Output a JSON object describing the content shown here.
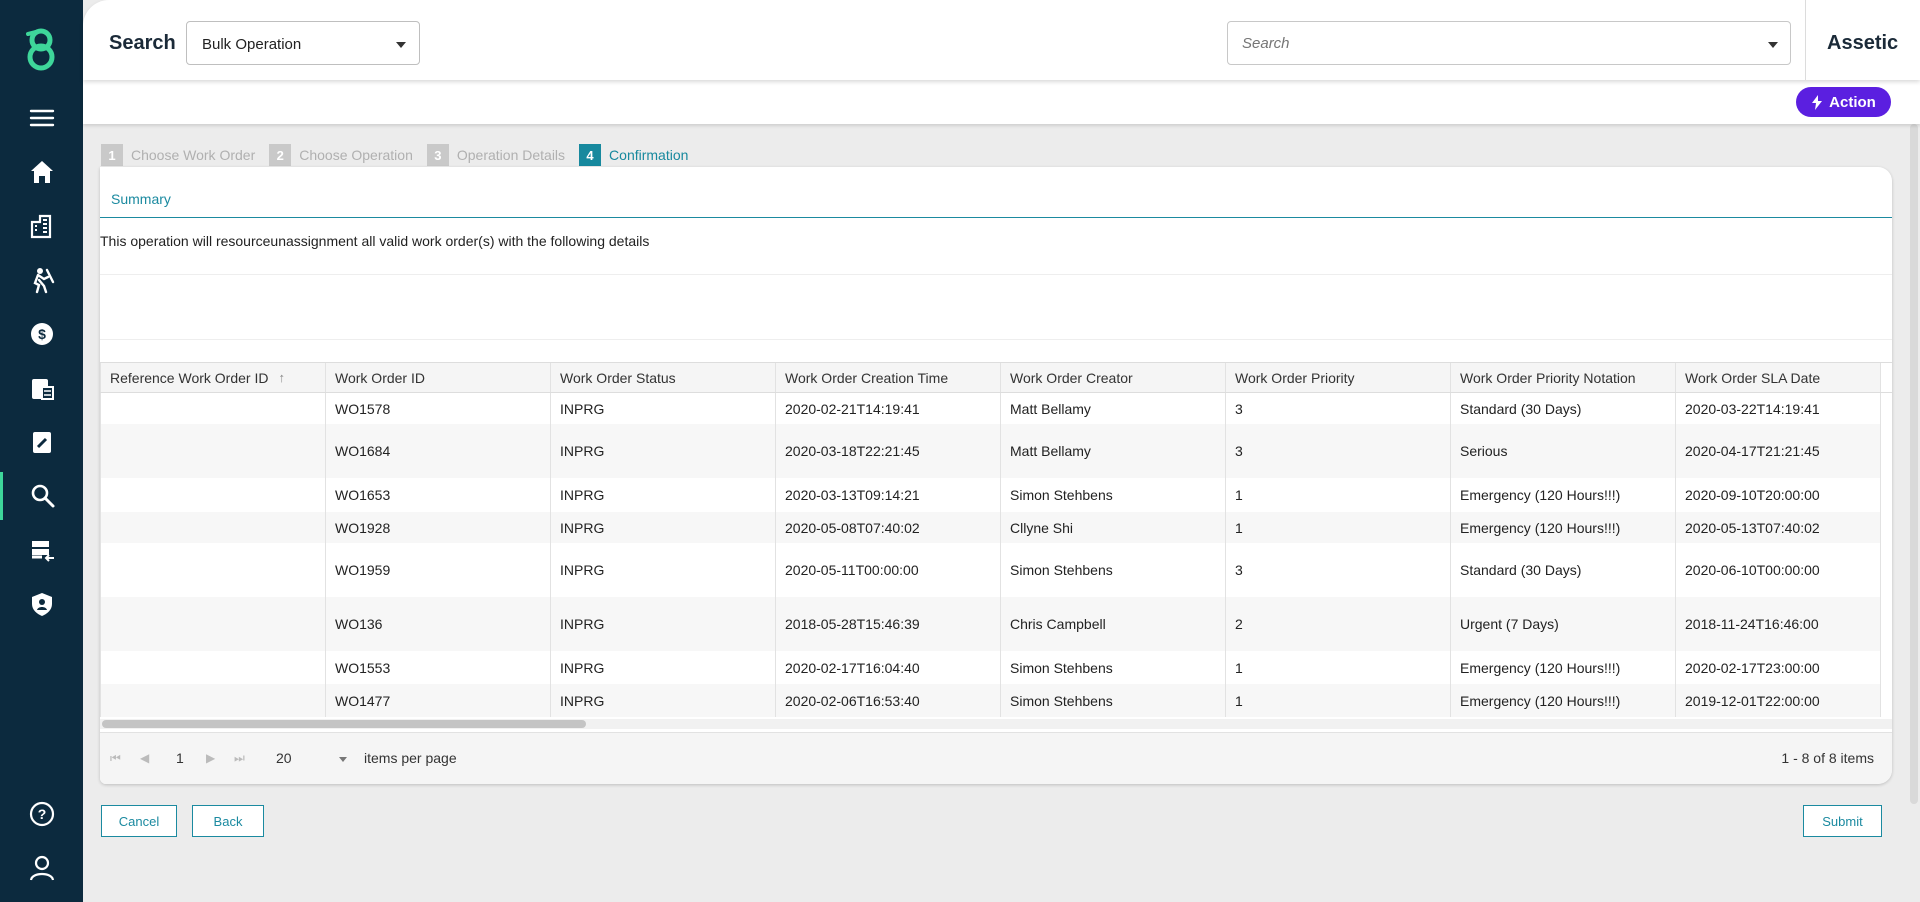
{
  "header": {
    "title": "Search",
    "operation_select": "Bulk Operation",
    "search_placeholder": "Search",
    "brand": "Assetic"
  },
  "action_button": "Action",
  "sidebar": {
    "items": [
      {
        "icon": "menu-icon"
      },
      {
        "icon": "home-icon"
      },
      {
        "icon": "buildings-icon"
      },
      {
        "icon": "worker-icon"
      },
      {
        "icon": "finance-icon"
      },
      {
        "icon": "clipboard-icon"
      },
      {
        "icon": "edit-clipboard-icon"
      },
      {
        "icon": "search-icon"
      },
      {
        "icon": "data-import-icon"
      },
      {
        "icon": "shield-user-icon"
      },
      {
        "icon": "help-icon"
      },
      {
        "icon": "user-icon"
      }
    ]
  },
  "steps": [
    {
      "num": "1",
      "label": "Choose Work Order"
    },
    {
      "num": "2",
      "label": "Choose Operation"
    },
    {
      "num": "3",
      "label": "Operation Details"
    },
    {
      "num": "4",
      "label": "Confirmation"
    }
  ],
  "summary": {
    "tab_label": "Summary",
    "description": "This operation will resourceunassignment all valid work order(s) with the following details"
  },
  "table": {
    "columns": [
      "Reference Work Order ID",
      "Work Order ID",
      "Work Order Status",
      "Work Order Creation Time",
      "Work Order Creator",
      "Work Order Priority",
      "Work Order Priority Notation",
      "Work Order SLA Date"
    ],
    "rows": [
      [
        "",
        "WO1578",
        "INPRG",
        "2020-02-21T14:19:41",
        "Matt Bellamy",
        "3",
        "Standard (30 Days)",
        "2020-03-22T14:19:41"
      ],
      [
        "",
        "WO1684",
        "INPRG",
        "2020-03-18T22:21:45",
        "Matt Bellamy",
        "3",
        "Serious",
        "2020-04-17T21:21:45"
      ],
      [
        "",
        "WO1653",
        "INPRG",
        "2020-03-13T09:14:21",
        "Simon Stehbens",
        "1",
        "Emergency (120 Hours!!!)",
        "2020-09-10T20:00:00"
      ],
      [
        "",
        "WO1928",
        "INPRG",
        "2020-05-08T07:40:02",
        "Cllyne Shi",
        "1",
        "Emergency (120 Hours!!!)",
        "2020-05-13T07:40:02"
      ],
      [
        "",
        "WO1959",
        "INPRG",
        "2020-05-11T00:00:00",
        "Simon Stehbens",
        "3",
        "Standard (30 Days)",
        "2020-06-10T00:00:00"
      ],
      [
        "",
        "WO136",
        "INPRG",
        "2018-05-28T15:46:39",
        "Chris Campbell",
        "2",
        "Urgent (7 Days)",
        "2018-11-24T16:46:00"
      ],
      [
        "",
        "WO1553",
        "INPRG",
        "2020-02-17T16:04:40",
        "Simon Stehbens",
        "1",
        "Emergency (120 Hours!!!)",
        "2020-02-17T23:00:00"
      ],
      [
        "",
        "WO1477",
        "INPRG",
        "2020-02-06T16:53:40",
        "Simon Stehbens",
        "1",
        "Emergency (120 Hours!!!)",
        "2019-12-01T22:00:00"
      ]
    ]
  },
  "pager": {
    "page": "1",
    "page_size": "20",
    "items_per_page_label": "items per page",
    "info": "1 - 8 of 8 items"
  },
  "buttons": {
    "cancel": "Cancel",
    "back": "Back",
    "submit": "Submit"
  },
  "colors": {
    "sidebar": "#0c2a3e",
    "accent": "#17899e",
    "action": "#5b1fe0",
    "logo": "#3ed69a"
  }
}
